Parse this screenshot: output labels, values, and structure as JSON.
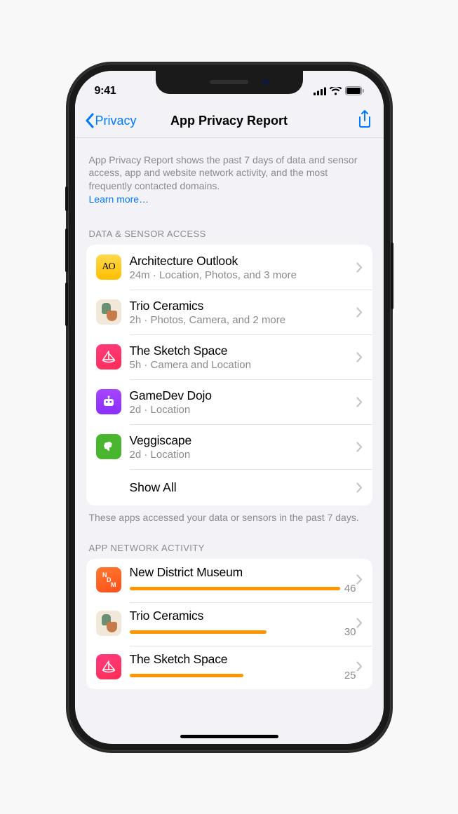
{
  "status": {
    "time": "9:41"
  },
  "nav": {
    "back_label": "Privacy",
    "title": "App Privacy Report"
  },
  "intro": {
    "text": "App Privacy Report shows the past 7 days of data and sensor access, app and website network activity, and the most frequently contacted domains.",
    "learn_more": "Learn more…"
  },
  "section1": {
    "header": "DATA & SENSOR ACCESS",
    "footer": "These apps accessed your data or sensors in the past 7 days.",
    "show_all": "Show All",
    "items": [
      {
        "name": "Architecture Outlook",
        "sub": "24m · Location, Photos, and 3 more",
        "icon": "ao",
        "badge": "AO"
      },
      {
        "name": "Trio Ceramics",
        "sub": "2h · Photos, Camera, and 2 more",
        "icon": "trio",
        "badge": ""
      },
      {
        "name": "The Sketch Space",
        "sub": "5h · Camera and Location",
        "icon": "sketch",
        "badge": ""
      },
      {
        "name": "GameDev Dojo",
        "sub": "2d · Location",
        "icon": "gamedev",
        "badge": ""
      },
      {
        "name": "Veggiscape",
        "sub": "2d · Location",
        "icon": "veggi",
        "badge": ""
      }
    ]
  },
  "section2": {
    "header": "APP NETWORK ACTIVITY",
    "max": 46,
    "items": [
      {
        "name": "New District Museum",
        "value": 46,
        "icon": "ndm"
      },
      {
        "name": "Trio Ceramics",
        "value": 30,
        "icon": "trio"
      },
      {
        "name": "The Sketch Space",
        "value": 25,
        "icon": "sketch"
      }
    ]
  },
  "colors": {
    "accent": "#007aff",
    "bar": "#ff9500"
  }
}
